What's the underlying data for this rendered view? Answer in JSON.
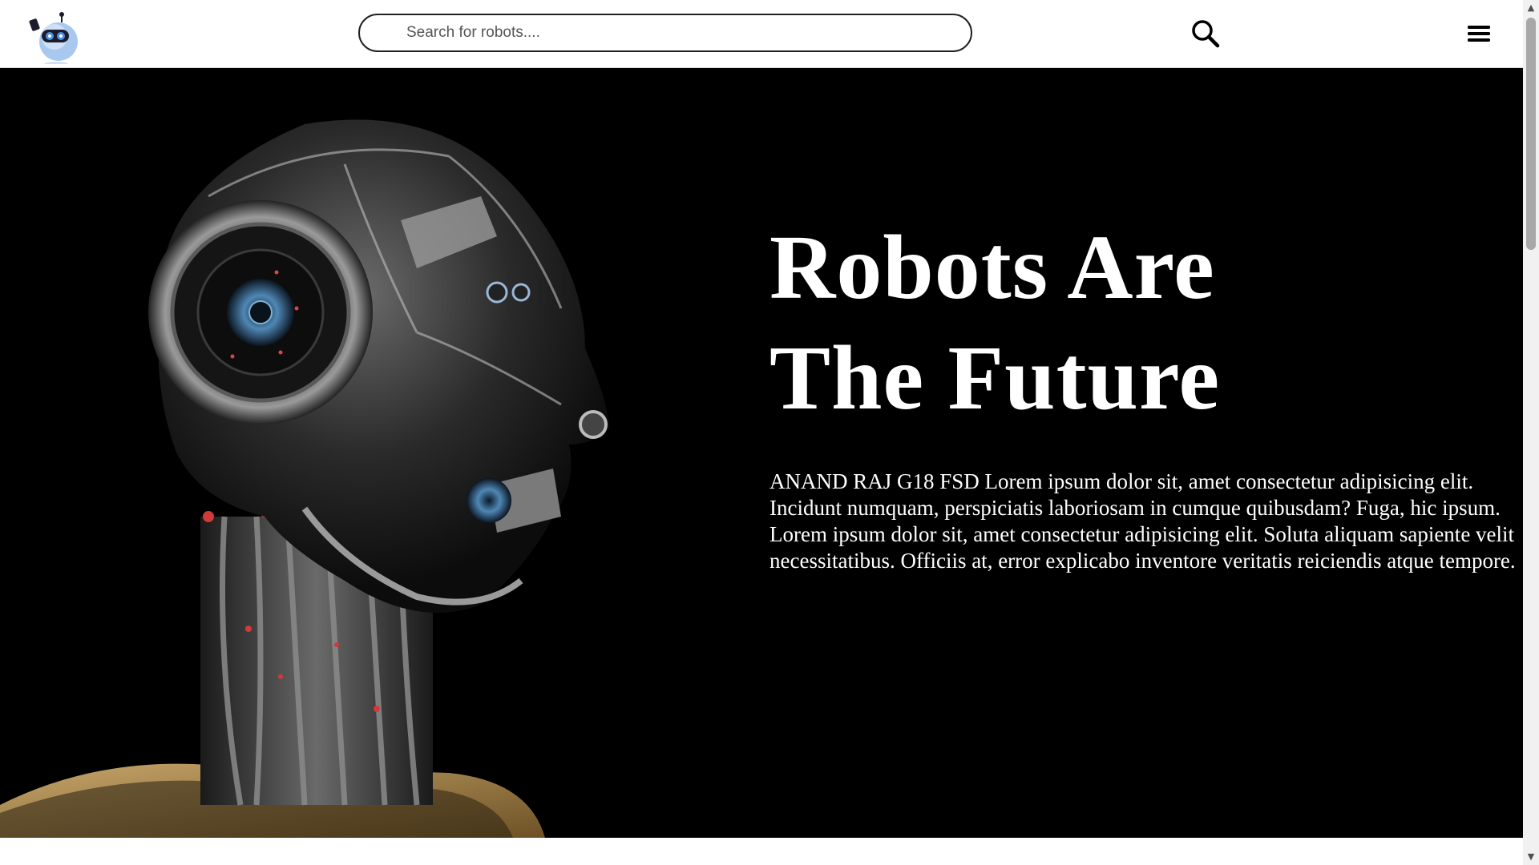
{
  "header": {
    "logo_icon": "robot-logo-icon",
    "search": {
      "placeholder": "Search for robots....",
      "value": "",
      "button_icon": "search-icon"
    },
    "menu_icon": "hamburger-menu-icon"
  },
  "hero": {
    "image_icon": "robot-head-image",
    "title_line1": "Robots Are",
    "title_line2": "The Future",
    "body": "ANAND RAJ G18 FSD Lorem ipsum dolor sit, amet consectetur adipisicing elit. Incidunt numquam, perspiciatis laboriosam in cumque quibusdam? Fuga, hic ipsum. Lorem ipsum dolor sit, amet consectetur adipisicing elit. Soluta aliquam sapiente velit necessitatibus. Officiis at, error explicabo inventore veritatis reiciendis atque tempore."
  },
  "colors": {
    "hero_background": "#000000",
    "hero_text": "#ffffff",
    "nav_background": "#ffffff",
    "logo_accent": "#a9c8f0"
  }
}
